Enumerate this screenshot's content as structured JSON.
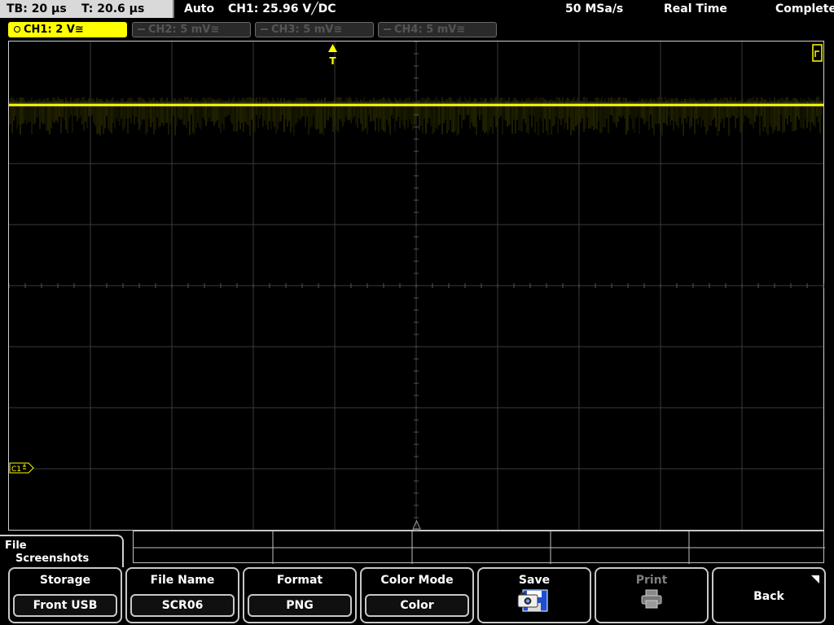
{
  "status": {
    "timebase": "TB: 20 μs",
    "trigger_time": "T: 20.6 μs",
    "trigger_mode": "Auto",
    "trigger_info": "CH1: 25.96 V╱DC",
    "sample_rate": "50 MSa/s",
    "acq_mode": "Real Time",
    "acq_state": "Complete"
  },
  "channels": [
    {
      "label": "CH1: 2 V≅",
      "active": true
    },
    {
      "label": "CH2: 5 mV≅",
      "active": false
    },
    {
      "label": "CH3: 5 mV≅",
      "active": false
    },
    {
      "label": "CH4: 5 mV≅",
      "active": false
    }
  ],
  "markers": {
    "trigger": "T",
    "channel_ref": "C1"
  },
  "menu": {
    "path_line1": "File",
    "path_line2": "Screenshots",
    "storage_title": "Storage",
    "storage_value": "Front USB",
    "filename_title": "File Name",
    "filename_value": "SCR06",
    "format_title": "Format",
    "format_value": "PNG",
    "colormode_title": "Color Mode",
    "colormode_value": "Color",
    "save_title": "Save",
    "print_title": "Print",
    "back_title": "Back"
  },
  "colors": {
    "ch1": "#ffff00",
    "grid": "#3a3a3a",
    "frame": "#d0d0d0"
  },
  "icons": {
    "save": "camera-disk-icon",
    "print": "printer-icon",
    "back": "corner-triangle-icon",
    "trigger": "trigger-arrow-icon"
  }
}
